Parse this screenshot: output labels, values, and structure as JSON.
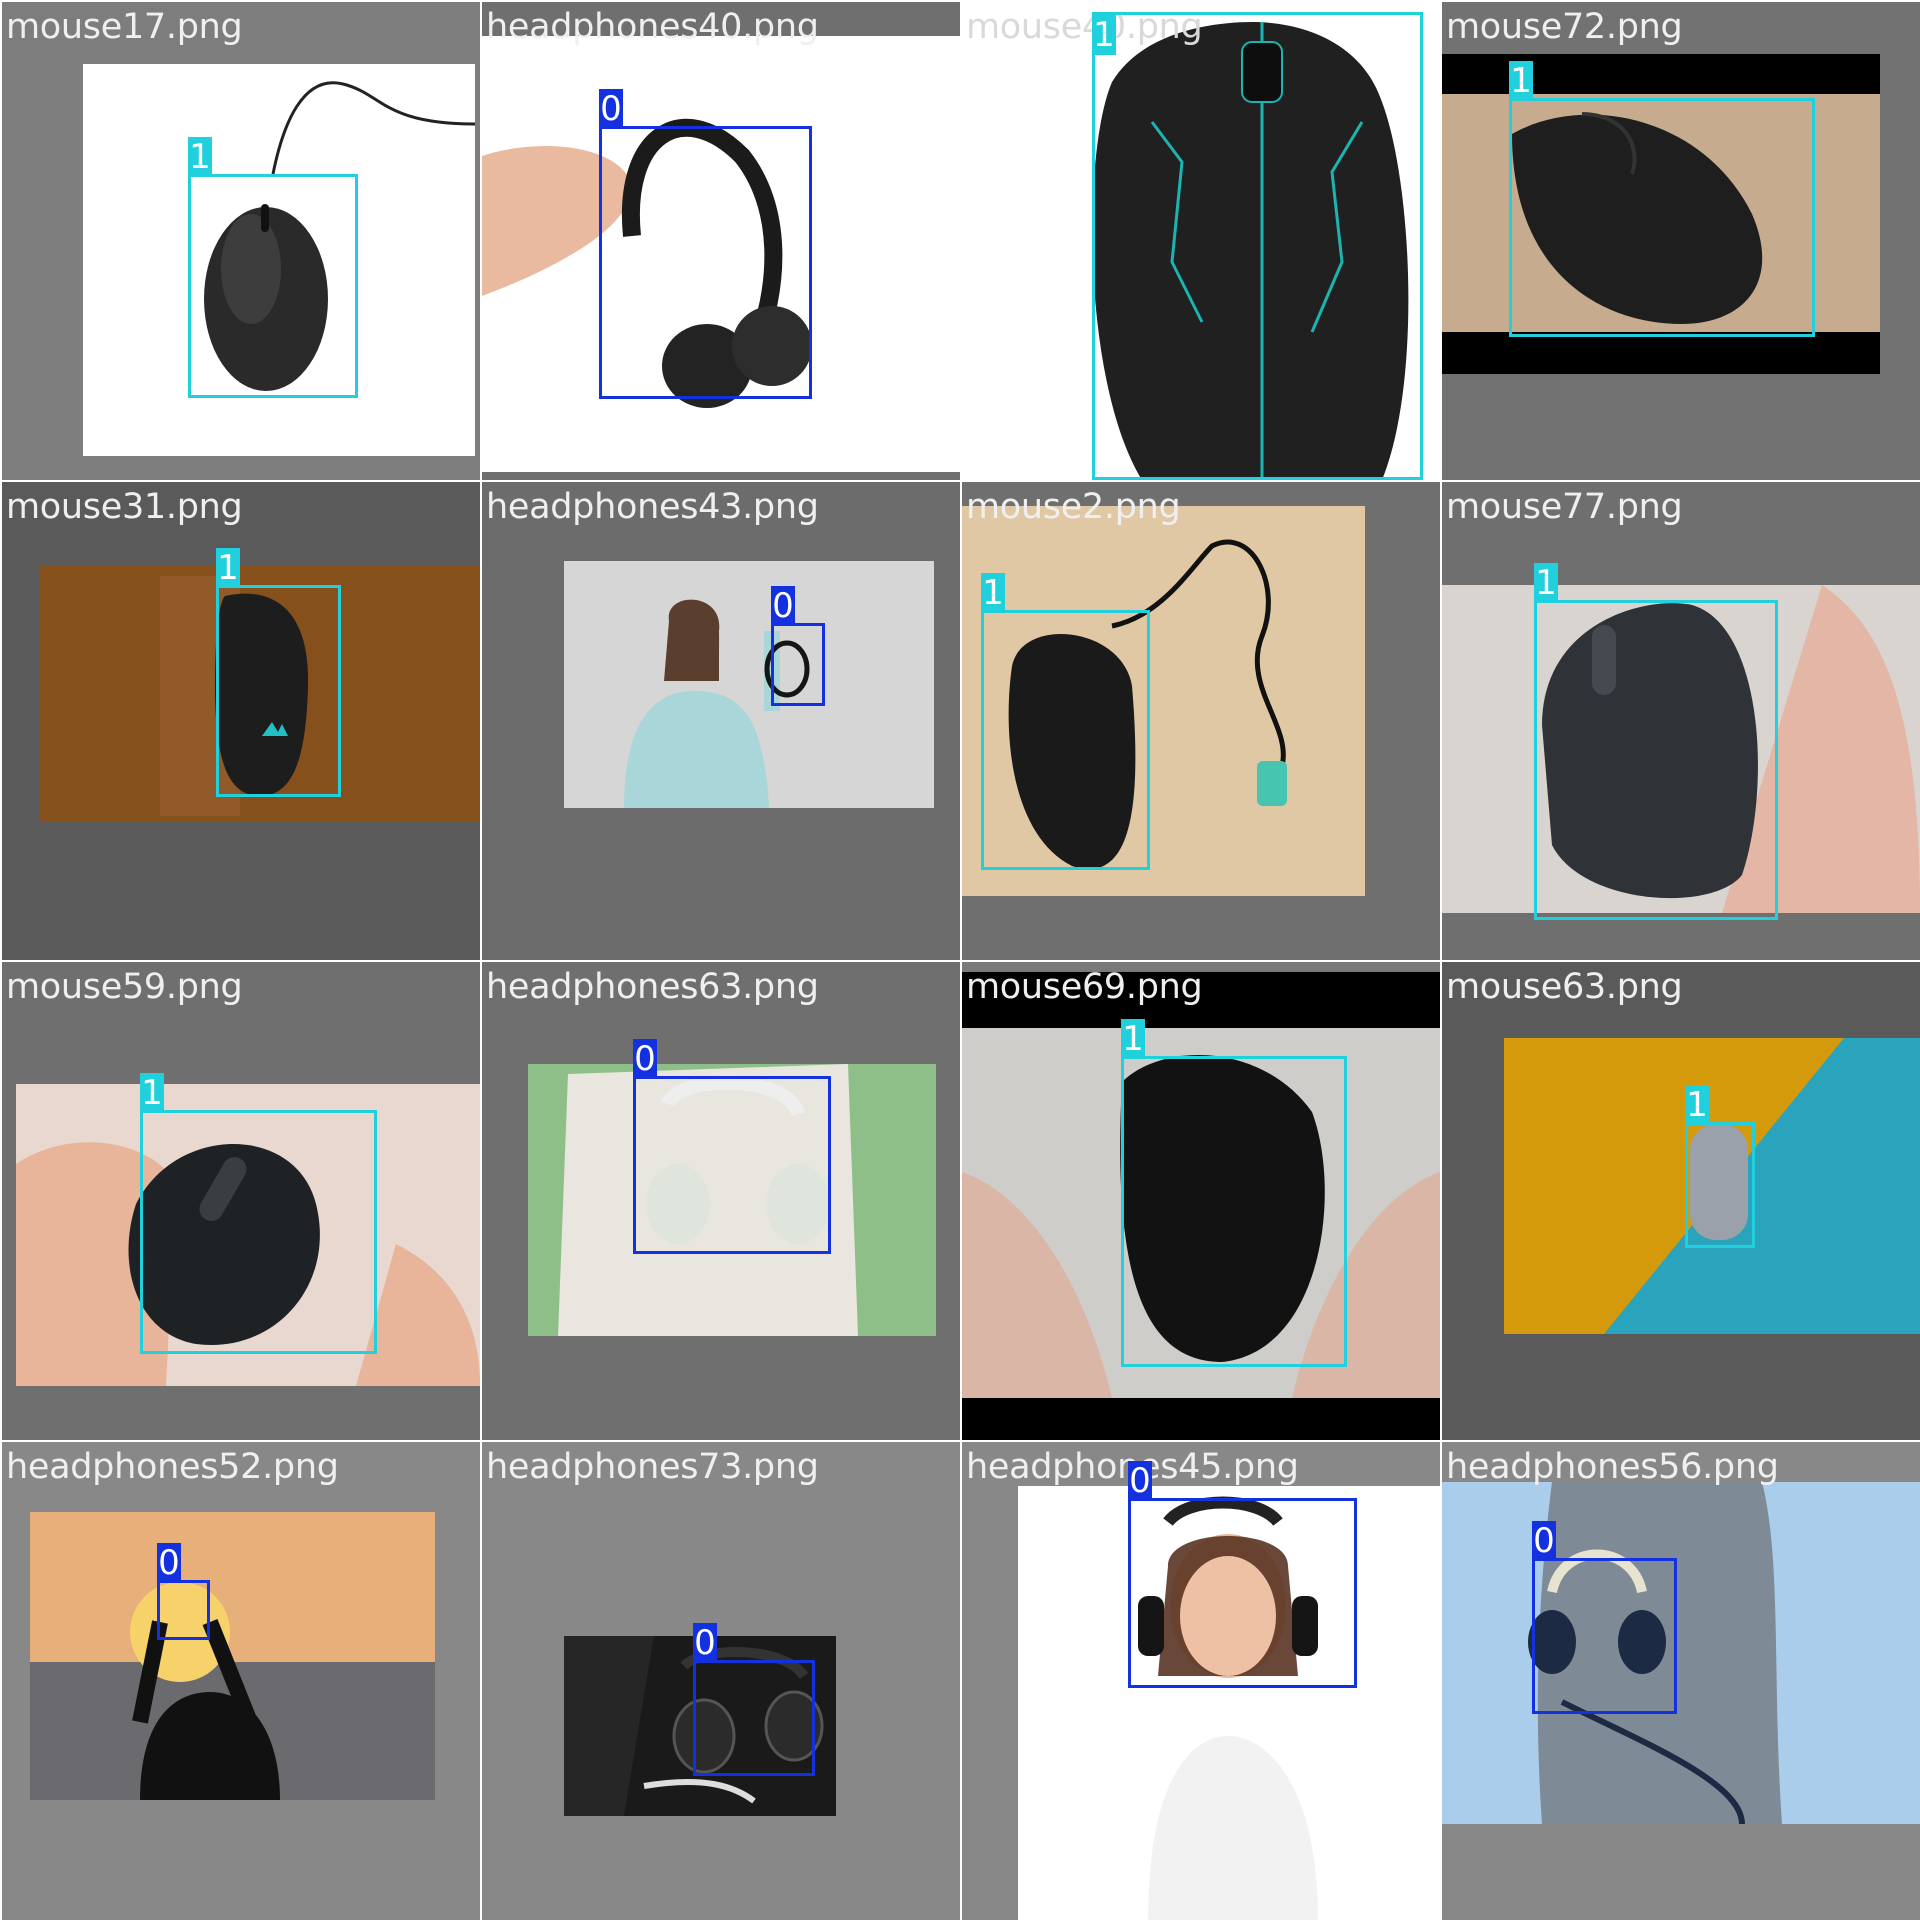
{
  "palette": {
    "class0": "#1431e0",
    "class1": "#20d0dc"
  },
  "tiles": [
    {
      "file": "mouse17.png",
      "cls": "1",
      "subject": "wired black mouse on white"
    },
    {
      "file": "headphones40.png",
      "cls": "0",
      "subject": "hand holding black headphones"
    },
    {
      "file": "mouse40.png",
      "cls": "1",
      "subject": "black gaming mouse with cyan lines"
    },
    {
      "file": "mouse72.png",
      "cls": "1",
      "subject": "black mouse on wooden desk"
    },
    {
      "file": "mouse31.png",
      "cls": "1",
      "subject": "black mouse on wood"
    },
    {
      "file": "headphones43.png",
      "cls": "0",
      "subject": "woman holding headphones"
    },
    {
      "file": "mouse2.png",
      "cls": "1",
      "subject": "black mouse with ps2 cable"
    },
    {
      "file": "mouse77.png",
      "cls": "1",
      "subject": "hand holding gray mouse"
    },
    {
      "file": "mouse59.png",
      "cls": "1",
      "subject": "hands holding black mouse"
    },
    {
      "file": "headphones63.png",
      "cls": "0",
      "subject": "person holding white headphones"
    },
    {
      "file": "mouse69.png",
      "cls": "1",
      "subject": "hands holding black mouse"
    },
    {
      "file": "mouse63.png",
      "cls": "1",
      "subject": "small gray mouse on yellow and teal"
    },
    {
      "file": "headphones52.png",
      "cls": "0",
      "subject": "silhouette at sunset"
    },
    {
      "file": "headphones73.png",
      "cls": "0",
      "subject": "hands with headphones on dark"
    },
    {
      "file": "headphones45.png",
      "cls": "0",
      "subject": "smiling woman with headphones"
    },
    {
      "file": "headphones56.png",
      "cls": "0",
      "subject": "hand holding headphones"
    }
  ]
}
